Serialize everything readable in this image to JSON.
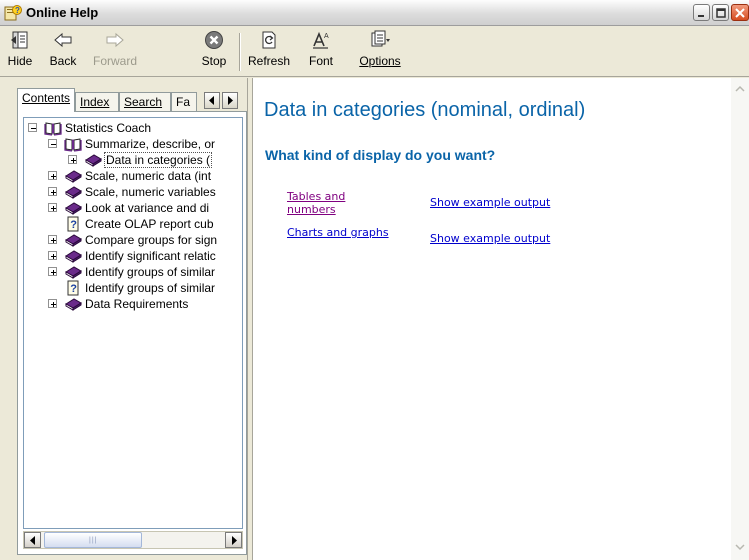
{
  "window": {
    "title": "Online Help"
  },
  "toolbar": {
    "buttons": [
      {
        "label": "Hide",
        "icon": "hide-icon",
        "enabled": true
      },
      {
        "label": "Back",
        "icon": "back-arrow-icon",
        "enabled": true
      },
      {
        "label": "Forward",
        "icon": "forward-arrow-icon",
        "enabled": false
      },
      {
        "label": "Stop",
        "icon": "stop-icon",
        "enabled": true
      },
      {
        "label": "Refresh",
        "icon": "refresh-icon",
        "enabled": true
      },
      {
        "label": "Font",
        "icon": "font-icon",
        "enabled": true
      },
      {
        "label": "Options",
        "icon": "options-icon",
        "enabled": true
      }
    ]
  },
  "tabs": [
    {
      "label": "Contents",
      "active": true
    },
    {
      "label": "Index",
      "active": false
    },
    {
      "label": "Search",
      "active": false
    },
    {
      "label": "Fa",
      "active": false
    }
  ],
  "tree": [
    {
      "label": "Statistics Coach",
      "type": "book-open",
      "toggle": "minus"
    },
    {
      "label": "Summarize, describe, or",
      "type": "book-open",
      "toggle": "minus"
    },
    {
      "label": "Data in categories (",
      "type": "book-closed",
      "toggle": "plus",
      "selected": true
    },
    {
      "label": "Scale, numeric data (int",
      "type": "book-closed",
      "toggle": "plus"
    },
    {
      "label": "Scale, numeric variables",
      "type": "book-closed",
      "toggle": "plus"
    },
    {
      "label": "Look at variance and di",
      "type": "book-closed",
      "toggle": "plus"
    },
    {
      "label": "Create OLAP report cub",
      "type": "help-page",
      "toggle": "none"
    },
    {
      "label": "Compare groups for sign",
      "type": "book-closed",
      "toggle": "plus"
    },
    {
      "label": "Identify significant relatic",
      "type": "book-closed",
      "toggle": "plus"
    },
    {
      "label": "Identify groups of similar",
      "type": "book-closed",
      "toggle": "plus"
    },
    {
      "label": "Identify groups of similar",
      "type": "help-page",
      "toggle": "none"
    },
    {
      "label": "Data Requirements",
      "type": "book-closed",
      "toggle": "plus"
    }
  ],
  "content": {
    "title": "Data in categories (nominal, ordinal)",
    "subtitle": "What kind of display do you want?",
    "links": [
      {
        "label_line1": "Tables and",
        "label_line2": "numbers",
        "example": "Show example output"
      },
      {
        "label_line1": "Charts and graphs",
        "label_line2": "",
        "example": "Show example output"
      }
    ]
  },
  "colors": {
    "heading": "#0a64a8",
    "link": "#0000cc",
    "visited_link": "#800080",
    "book": "#6a2a8a"
  }
}
